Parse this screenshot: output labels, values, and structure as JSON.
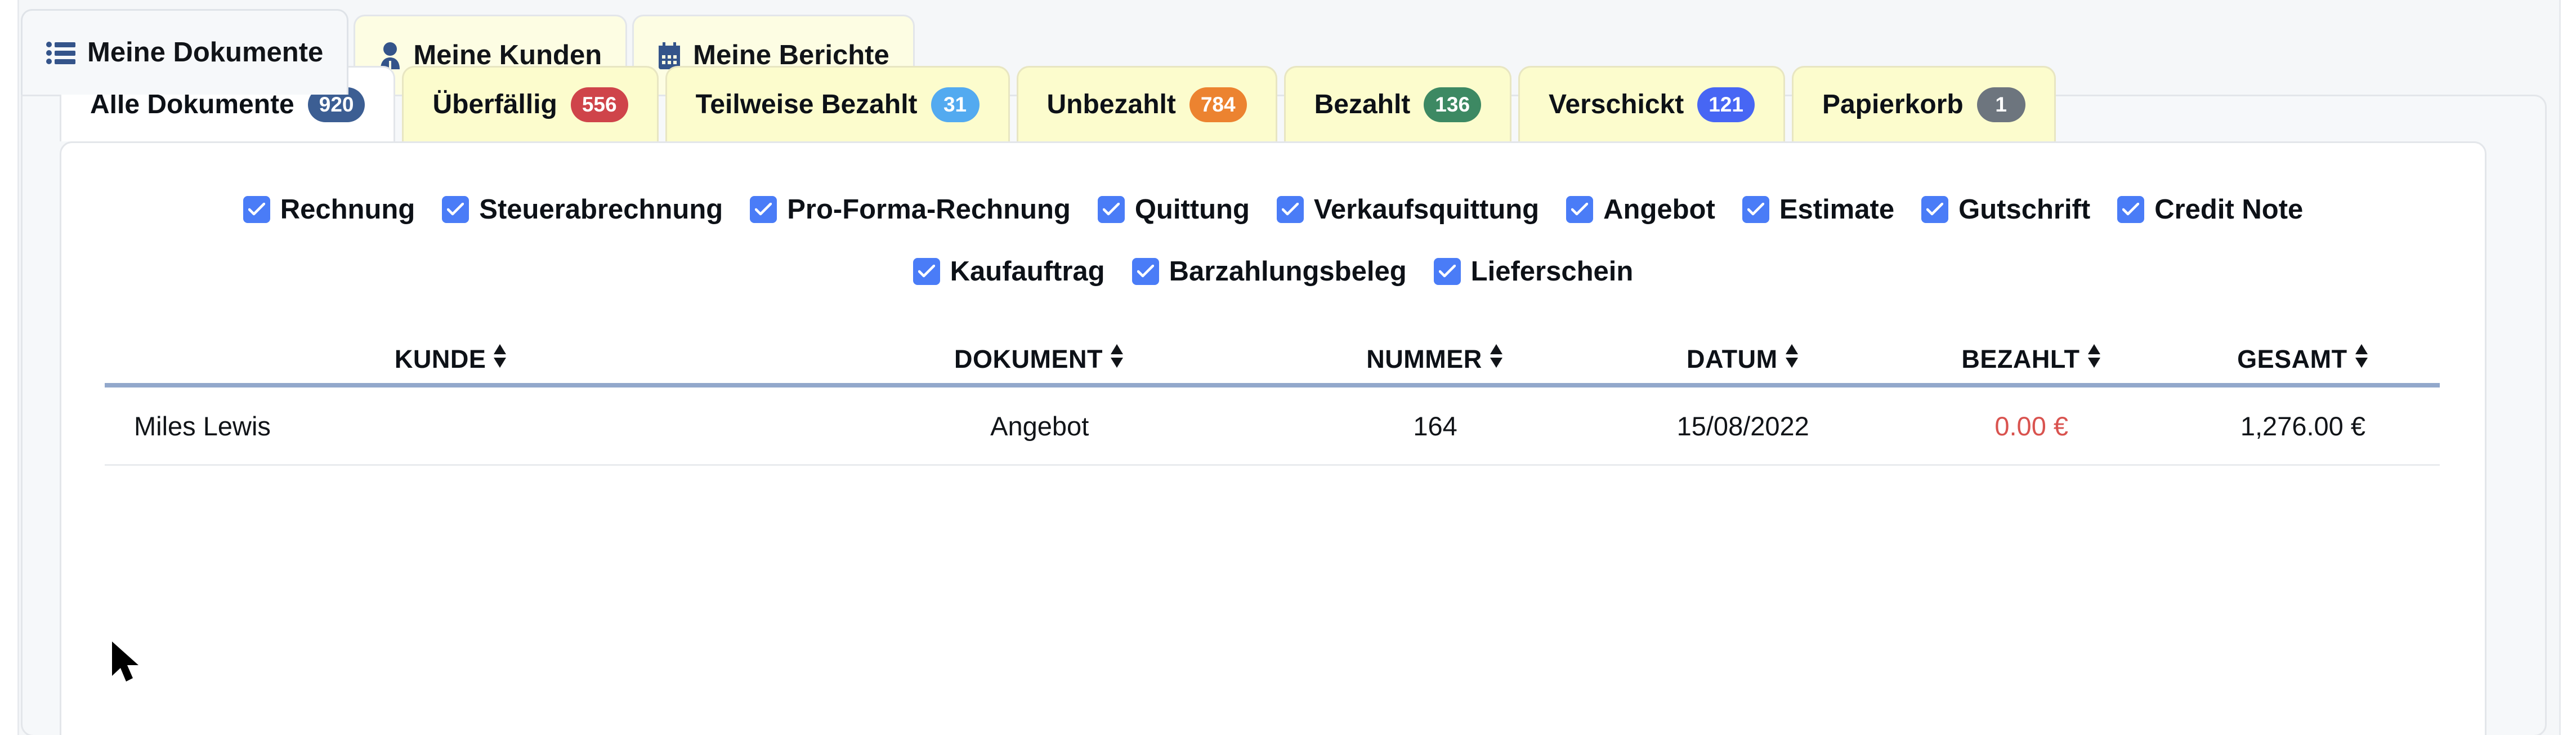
{
  "primary_tabs": [
    {
      "label": "Meine Dokumente",
      "icon": "list-icon",
      "active": true
    },
    {
      "label": "Meine Kunden",
      "icon": "user-icon",
      "active": false
    },
    {
      "label": "Meine Berichte",
      "icon": "calendar-icon",
      "active": false
    }
  ],
  "sub_tabs": [
    {
      "label": "Alle Dokumente",
      "count": "920",
      "badge_color": "#3c5e93",
      "active": true
    },
    {
      "label": "Überfällig",
      "count": "556",
      "badge_color": "#cf444a",
      "active": false
    },
    {
      "label": "Teilweise Bezahlt",
      "count": "31",
      "badge_color": "#53aaf0",
      "active": false
    },
    {
      "label": "Unbezahlt",
      "count": "784",
      "badge_color": "#ec8330",
      "active": false
    },
    {
      "label": "Bezahlt",
      "count": "136",
      "badge_color": "#3d8963",
      "active": false
    },
    {
      "label": "Verschickt",
      "count": "121",
      "badge_color": "#4766f4",
      "active": false
    },
    {
      "label": "Papierkorb",
      "count": "1",
      "badge_color": "#6d757e",
      "active": false
    }
  ],
  "filters": {
    "row1": [
      {
        "label": "Rechnung",
        "checked": true
      },
      {
        "label": "Steuerabrechnung",
        "checked": true
      },
      {
        "label": "Pro-Forma-Rechnung",
        "checked": true
      },
      {
        "label": "Quittung",
        "checked": true
      },
      {
        "label": "Verkaufsquittung",
        "checked": true
      },
      {
        "label": "Angebot",
        "checked": true
      },
      {
        "label": "Estimate",
        "checked": true
      },
      {
        "label": "Gutschrift",
        "checked": true
      },
      {
        "label": "Credit Note",
        "checked": true
      }
    ],
    "row2": [
      {
        "label": "Kaufauftrag",
        "checked": true
      },
      {
        "label": "Barzahlungsbeleg",
        "checked": true
      },
      {
        "label": "Lieferschein",
        "checked": true
      }
    ]
  },
  "table": {
    "columns": [
      {
        "key": "kunde",
        "label": "KUNDE",
        "sortable": true
      },
      {
        "key": "dokument",
        "label": "DOKUMENT",
        "sortable": true
      },
      {
        "key": "nummer",
        "label": "NUMMER",
        "sortable": true
      },
      {
        "key": "datum",
        "label": "DATUM",
        "sortable": true
      },
      {
        "key": "bezahlt",
        "label": "BEZAHLT",
        "sortable": true
      },
      {
        "key": "gesamt",
        "label": "GESAMT",
        "sortable": true
      }
    ],
    "rows": [
      {
        "kunde": "Miles Lewis",
        "dokument": "Angebot",
        "nummer": "164",
        "datum": "15/08/2022",
        "bezahlt": "0.00 €",
        "gesamt": "1,276.00 €"
      }
    ]
  },
  "colors": {
    "checkbox_blue": "#4a7cf7",
    "unpaid_red": "#d9534f",
    "header_rule": "#92a8cb",
    "tab_yellow": "#fcfccd",
    "icon_navy": "#34548a"
  },
  "cursor": {
    "type": "arrow-pointer"
  }
}
